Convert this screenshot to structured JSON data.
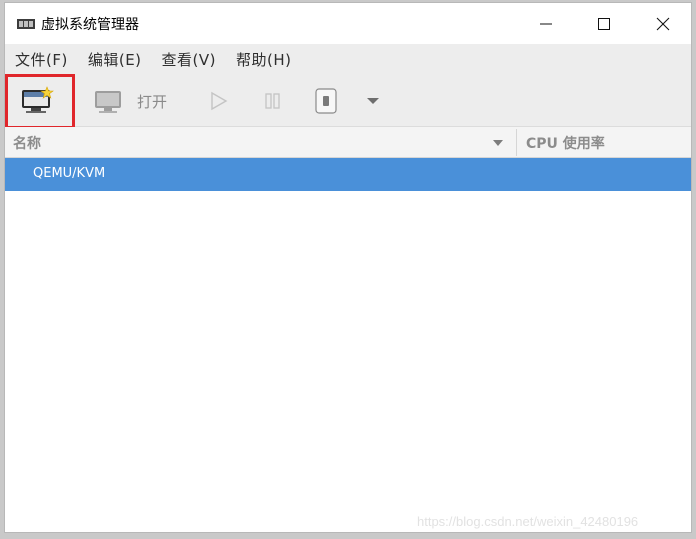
{
  "window": {
    "title": "虚拟系统管理器",
    "icon": "vm-app-icon",
    "controls": [
      "minimize-icon",
      "maximize-icon",
      "close-icon"
    ]
  },
  "menubar": {
    "items": [
      {
        "label": "文件(F)"
      },
      {
        "label": "编辑(E)"
      },
      {
        "label": "查看(V)"
      },
      {
        "label": "帮助(H)"
      }
    ]
  },
  "toolbar": {
    "new_vm_icon": "new-vm-icon",
    "open_label": "打开",
    "highlight_color": "#e0262b"
  },
  "table": {
    "columns": [
      "名称",
      "CPU 使用率"
    ],
    "rows": [
      {
        "name": "QEMU/KVM",
        "selected": true
      }
    ],
    "selection_color": "#4a90d9"
  },
  "watermark": "https://blog.csdn.net/weixin_42480196"
}
